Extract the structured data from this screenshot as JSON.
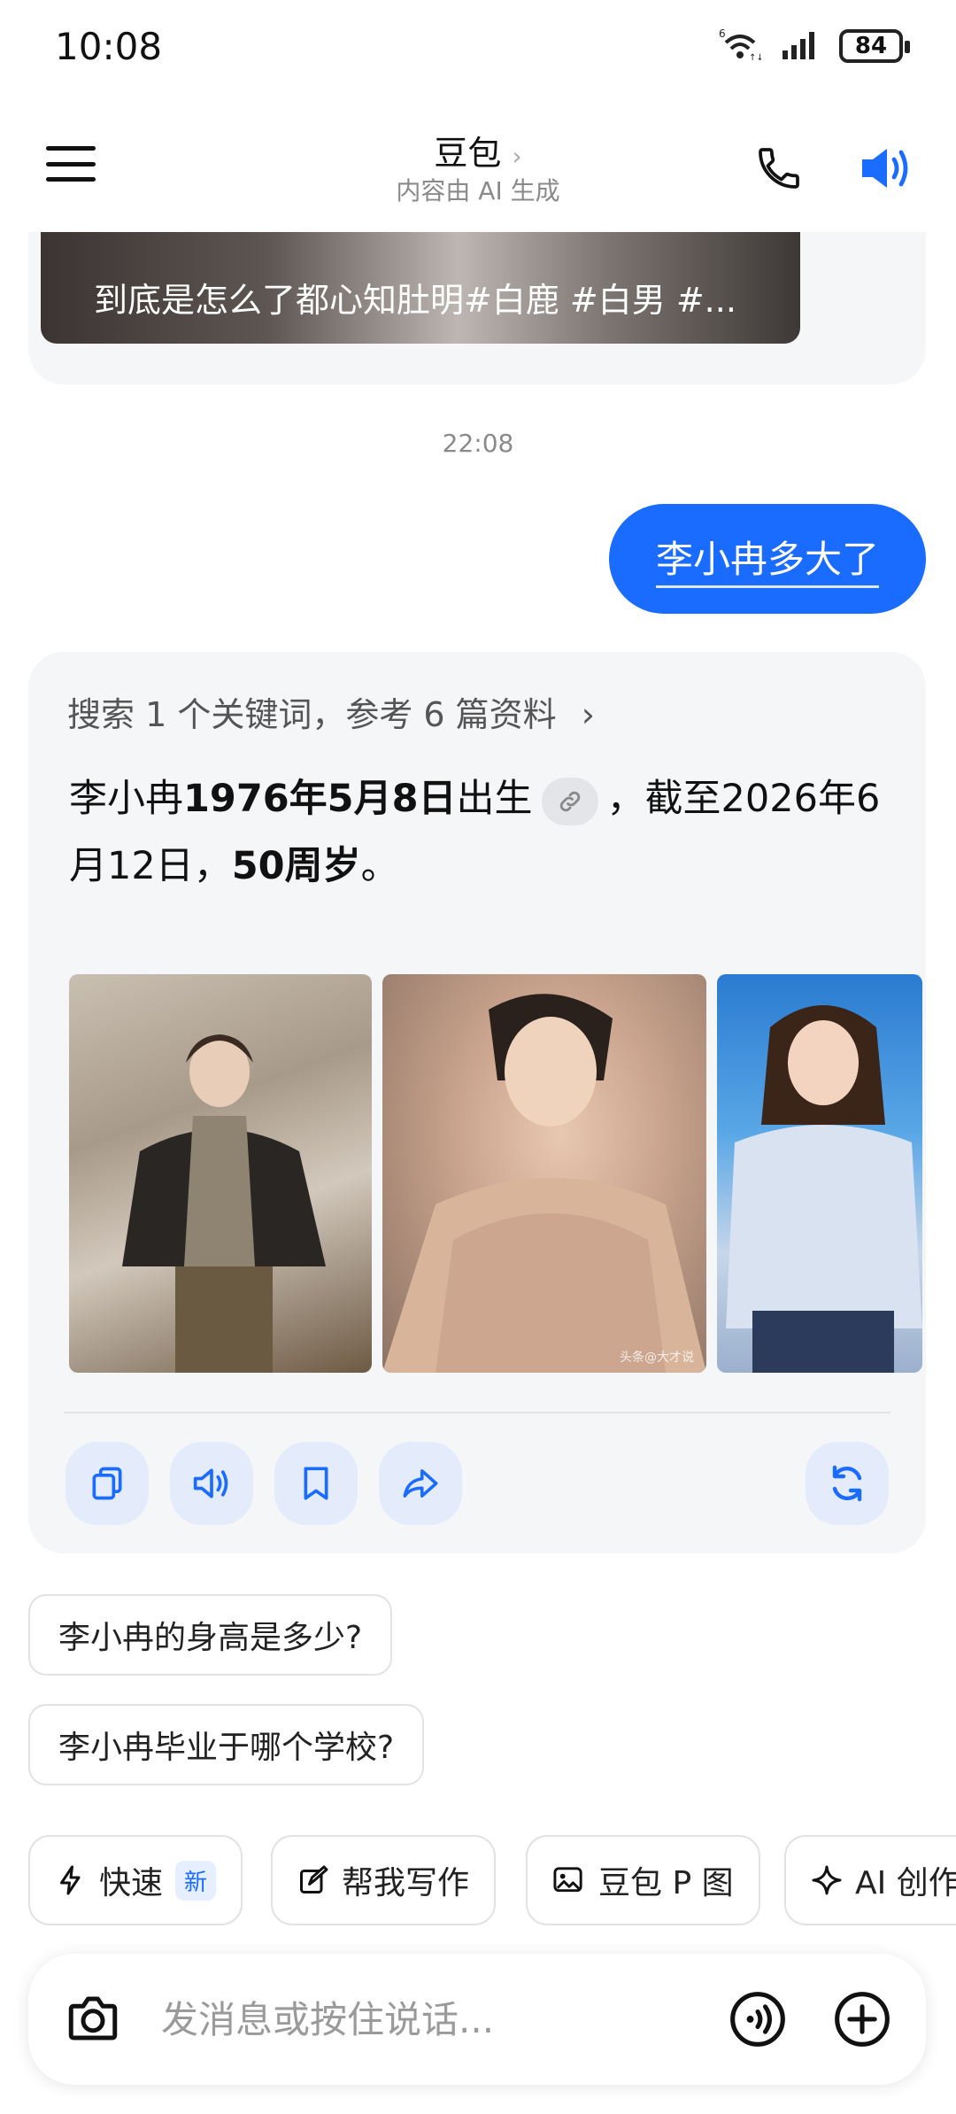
{
  "status_bar": {
    "time": "10:08",
    "wifi_label": "6",
    "battery": "84"
  },
  "header": {
    "title": "豆包",
    "subtitle": "内容由 AI 生成"
  },
  "chat": {
    "prev_video_caption": "到底是怎么了都心知肚明#白鹿 #白男 #...",
    "timestamp": "22:08",
    "user_message": "李小冉多大了",
    "answer": {
      "search_summary": "搜索 1 个关键词，参考 6 篇资料",
      "text_part1": "李小冉",
      "text_bold1": "1976年5月8日",
      "text_part2": "出生",
      "text_part3": "，截至2026年6月12日，",
      "text_bold2": "50周岁",
      "text_part4": "。",
      "photos": [
        {
          "name": "photo-1"
        },
        {
          "name": "photo-2",
          "watermark": "头条@大才说"
        },
        {
          "name": "photo-3"
        }
      ]
    }
  },
  "suggestions": [
    "李小冉的身高是多少?",
    "李小冉毕业于哪个学校?"
  ],
  "quick_chips": [
    {
      "label": "快速",
      "badge": "新"
    },
    {
      "label": "帮我写作"
    },
    {
      "label": "豆包 P 图"
    },
    {
      "label": "AI 创作"
    }
  ],
  "input": {
    "placeholder": "发消息或按住说话..."
  },
  "colors": {
    "accent": "#1a6bff",
    "card_bg": "#f5f6f8",
    "action_bg": "#e4ecfb"
  }
}
